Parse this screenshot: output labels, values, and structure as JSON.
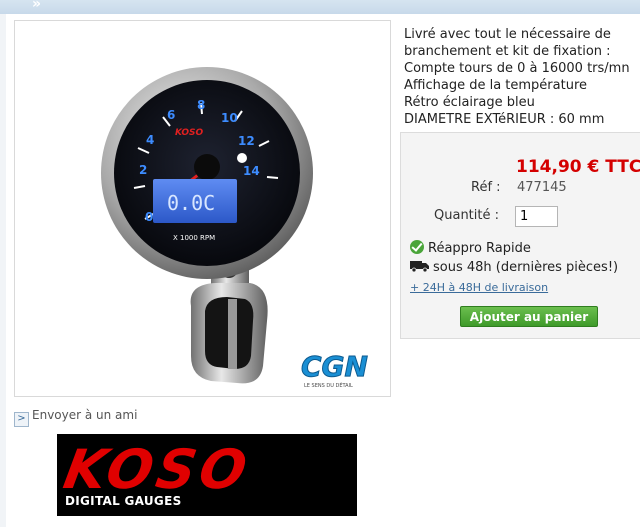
{
  "description_lines": [
    "Livré avec tout le nécessaire de",
    "branchement et kit de fixation :",
    "Compte tours de 0 à 16000 trs/mn",
    "Affichage de la température",
    "Rétro éclairage bleu",
    "DIAMETRE EXTéRIEUR : 60 mm"
  ],
  "price": "114,90 € TTC",
  "ref": {
    "label": "Réf :",
    "value": "477145"
  },
  "quantity": {
    "label": "Quantité :",
    "value": "1"
  },
  "availability": "Réappro Rapide",
  "shipping": "sous 48h (dernières pièces!)",
  "delivery_link": "+ 24H à 48H de livraison",
  "add_to_cart": "Ajouter au panier",
  "send_friend": "Envoyer à un ami",
  "gauge": {
    "ticks": [
      "0",
      "2",
      "4",
      "6",
      "8",
      "10",
      "12",
      "14"
    ],
    "brand": "KOSO",
    "lcd": "0.0C",
    "unit": "X 1000 RPM"
  },
  "cgn_logo": {
    "text": "CGN",
    "tagline": "LE SENS DU DÉTAIL"
  },
  "koso_logo": {
    "text": "KOSO",
    "subtitle": "DIGITAL GAUGES"
  },
  "colors": {
    "price": "#d40000",
    "button": "#3f9a2a",
    "lcd": "#3b6fe0"
  }
}
